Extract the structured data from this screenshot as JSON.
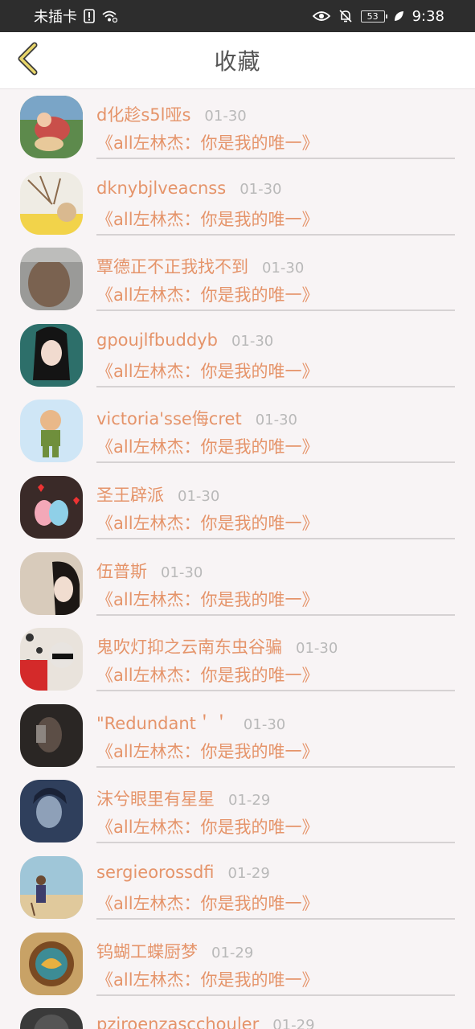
{
  "status_bar": {
    "carrier": "未插卡",
    "battery": "53",
    "time": "9:38"
  },
  "header": {
    "title": "收藏"
  },
  "colors": {
    "accent": "#e5946a",
    "back_chevron": "#e8d66a",
    "date": "#b9b9b9"
  },
  "favorites": [
    {
      "name": "d化趁s5l哑s",
      "date": "01-30",
      "subtitle": "《all左林杰：你是我的唯一》"
    },
    {
      "name": "dknybjlveacnss",
      "date": "01-30",
      "subtitle": "《all左林杰：你是我的唯一》"
    },
    {
      "name": "覃德正不正我找不到",
      "date": "01-30",
      "subtitle": "《all左林杰：你是我的唯一》"
    },
    {
      "name": "gpoujlfbuddyb",
      "date": "01-30",
      "subtitle": "《all左林杰：你是我的唯一》"
    },
    {
      "name": "victoria'sse侮cret",
      "date": "01-30",
      "subtitle": "《all左林杰：你是我的唯一》"
    },
    {
      "name": "圣王辟派",
      "date": "01-30",
      "subtitle": "《all左林杰：你是我的唯一》"
    },
    {
      "name": "伍普斯",
      "date": "01-30",
      "subtitle": "《all左林杰：你是我的唯一》"
    },
    {
      "name": "鬼吹灯抑之云南东虫谷骗",
      "date": "01-30",
      "subtitle": "《all左林杰：你是我的唯一》"
    },
    {
      "name": "\"Redundant＇＇",
      "date": "01-30",
      "subtitle": "《all左林杰：你是我的唯一》"
    },
    {
      "name": "沫兮眼里有星星",
      "date": "01-29",
      "subtitle": "《all左林杰：你是我的唯一》"
    },
    {
      "name": "sergieorossdfi",
      "date": "01-29",
      "subtitle": "《all左林杰：你是我的唯一》"
    },
    {
      "name": "钨蝴工蝶厨梦",
      "date": "01-29",
      "subtitle": "《all左林杰：你是我的唯一》"
    },
    {
      "name": "pziroenzascchouler",
      "date": "01-29",
      "subtitle": ""
    }
  ]
}
